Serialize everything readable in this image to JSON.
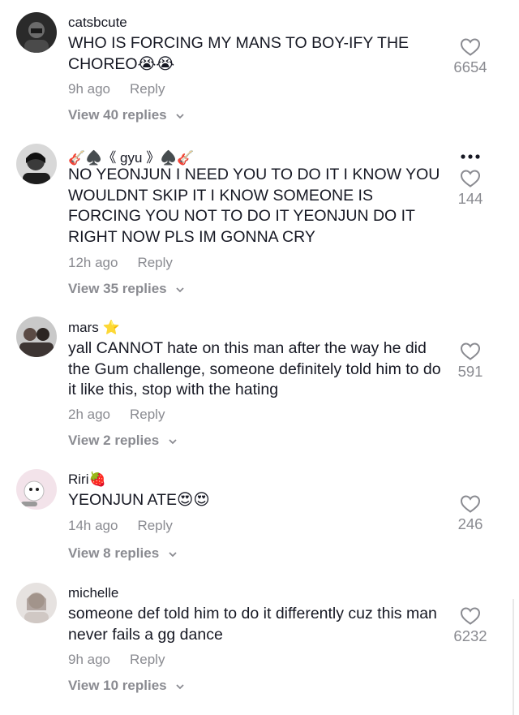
{
  "comments": [
    {
      "username": "catsbcute",
      "text": "WHO IS FORCING MY MANS TO BOY-IFY THE CHOREO😭😭",
      "time": "9h ago",
      "reply": "Reply",
      "view_replies": "View 40 replies",
      "likes": "6654"
    },
    {
      "username": "🎸♠️《 gyu 》♠️🎸",
      "text": "NO YEONJUN I NEED YOU TO DO IT I KNOW YOU WOULDNT SKIP IT I KNOW SOMEONE IS FORCING YOU NOT TO DO IT YEONJUN DO IT RIGHT NOW PLS IM GONNA CRY",
      "time": "12h ago",
      "reply": "Reply",
      "view_replies": "View 35 replies",
      "likes": "144"
    },
    {
      "username": "mars ⭐",
      "text": "yall CANNOT hate on this man after the way he did the Gum challenge, someone definitely told him to do it like this, stop with the hating",
      "time": "2h ago",
      "reply": "Reply",
      "view_replies": "View 2 replies",
      "likes": "591"
    },
    {
      "username": "Riri🍓",
      "text": "YEONJUN ATE😍😍",
      "time": "14h ago",
      "reply": "Reply",
      "view_replies": "View 8 replies",
      "likes": "246"
    },
    {
      "username": "michelle",
      "text": "someone def told him to do it differently cuz this man never fails a gg dance",
      "time": "9h ago",
      "reply": "Reply",
      "view_replies": "View 10 replies",
      "likes": "6232"
    }
  ],
  "icons": {
    "like": "heart-outline-icon",
    "more": "more-dots-icon",
    "expand": "chevron-down-icon"
  },
  "colors": {
    "text": "#161823",
    "secondary": "#8a8b91"
  }
}
